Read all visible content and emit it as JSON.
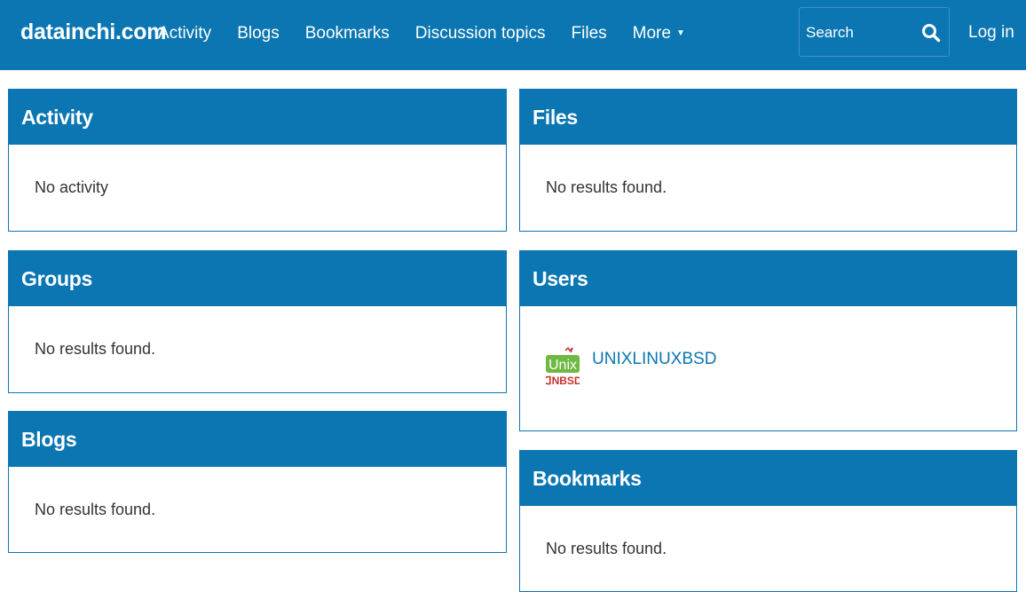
{
  "header": {
    "brand": "datainchi.com",
    "nav": [
      "Activity",
      "Blogs",
      "Bookmarks",
      "Discussion topics",
      "Files",
      "More"
    ],
    "search_placeholder": "Search",
    "login": "Log in"
  },
  "panels": {
    "activity": {
      "title": "Activity",
      "body": "No activity"
    },
    "groups": {
      "title": "Groups",
      "body": "No results found."
    },
    "blogs": {
      "title": "Blogs",
      "body": "No results found."
    },
    "files": {
      "title": "Files",
      "body": "No results found."
    },
    "users": {
      "title": "Users",
      "user_name": "UNIXLINUXBSD",
      "avatar_text_top": "Unix",
      "avatar_text_bottom": "ᗡNBSD"
    },
    "bookmarks": {
      "title": "Bookmarks",
      "body": "No results found."
    }
  },
  "colors": {
    "brand_blue": "#0b76b1",
    "avatar_green": "#6fb842",
    "avatar_red": "#c6302c"
  },
  "icons": {
    "search": "search-icon",
    "more_caret": "chevron-down-icon"
  }
}
